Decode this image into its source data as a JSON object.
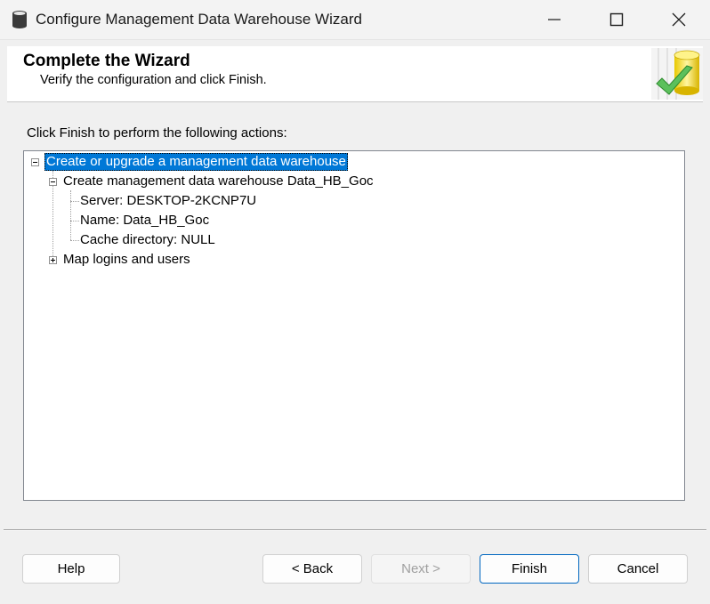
{
  "window": {
    "title": "Configure Management Data Warehouse Wizard",
    "icon": "database-icon"
  },
  "header": {
    "title": "Complete the Wizard",
    "subtitle": "Verify the configuration and click Finish.",
    "logo": "wizard-database-logo"
  },
  "main": {
    "instruction": "Click Finish to perform the following actions:",
    "tree": {
      "root": {
        "label": "Create or upgrade a management data warehouse",
        "expanded": true,
        "selected": true
      },
      "child1": {
        "label": "Create management data warehouse Data_HB_Goc",
        "expanded": true
      },
      "child1_items": [
        "Server: DESKTOP-2KCNP7U",
        "Name: Data_HB_Goc",
        "Cache directory: NULL"
      ],
      "child2": {
        "label": "Map logins and users",
        "expanded": false
      }
    }
  },
  "buttons": {
    "help": "Help",
    "back": "< Back",
    "next": "Next >",
    "finish": "Finish",
    "cancel": "Cancel"
  },
  "colors": {
    "selection": "#0078d7",
    "default_button_border": "#0067c0"
  }
}
